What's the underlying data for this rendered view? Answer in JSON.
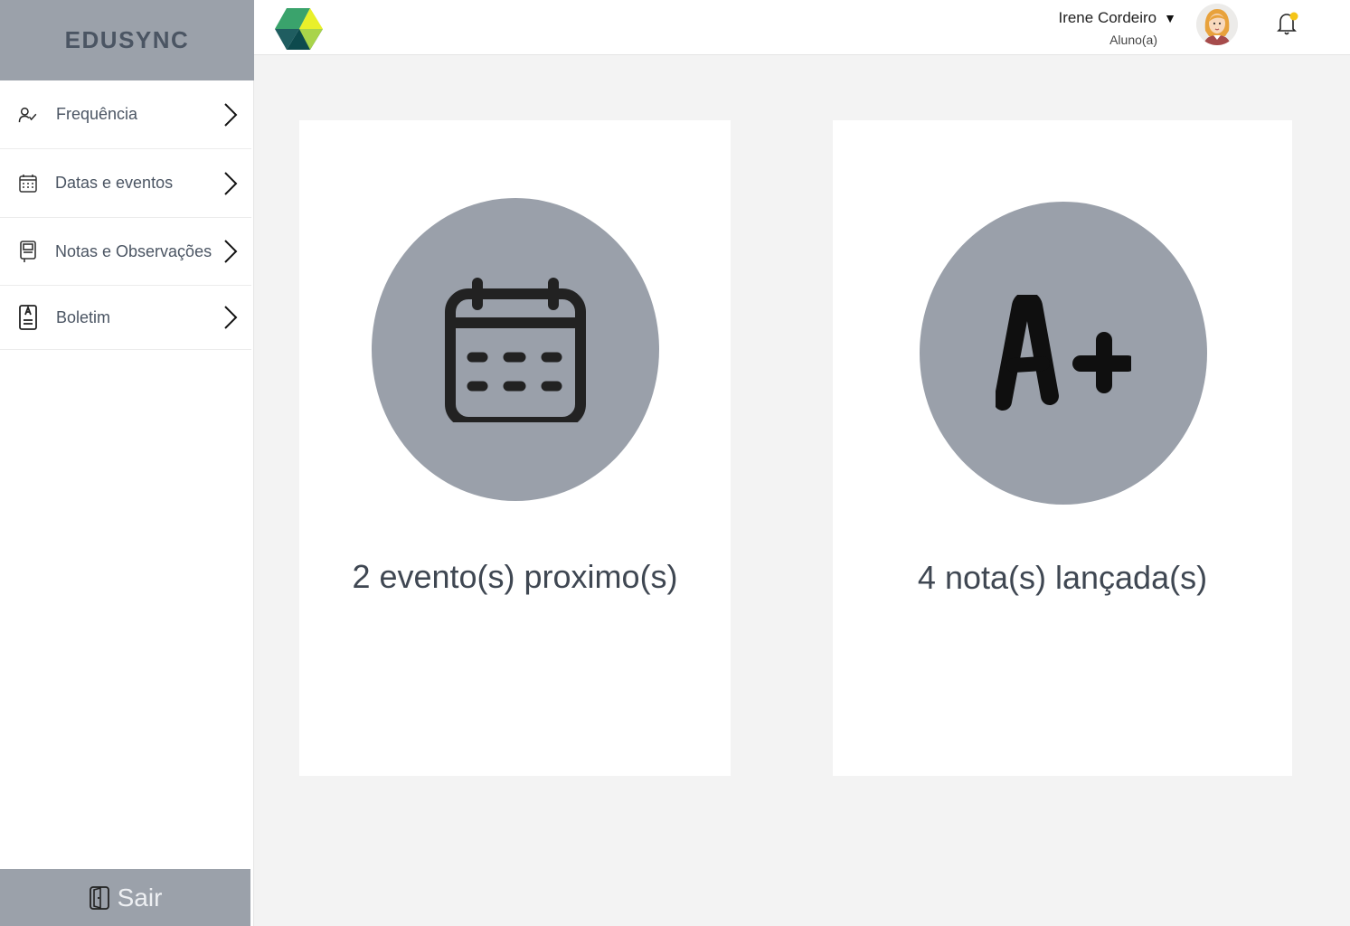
{
  "app": {
    "brand": "EDUSYNC"
  },
  "sidebar": {
    "items": [
      {
        "label": "Frequência",
        "icon": "user-check-icon"
      },
      {
        "label": "Datas e eventos",
        "icon": "calendar-icon"
      },
      {
        "label": "Notas e Observações",
        "icon": "notebook-icon"
      },
      {
        "label": "Boletim",
        "icon": "report-card-icon"
      }
    ],
    "logout_label": "Sair"
  },
  "header": {
    "user_name": "Irene Cordeiro",
    "caret": "▼",
    "user_role": "Aluno(a)"
  },
  "cards": [
    {
      "text": "2 evento(s) proximo(s)",
      "icon": "calendar-icon"
    },
    {
      "text": "4 nota(s) lançada(s)",
      "icon": "grade-a-plus-icon"
    }
  ],
  "colors": {
    "sidebar_brand_bg": "#9ba1aa",
    "circle_bg": "#9aa0aa",
    "page_bg": "#f3f3f3",
    "notification_dot": "#f5c518"
  }
}
